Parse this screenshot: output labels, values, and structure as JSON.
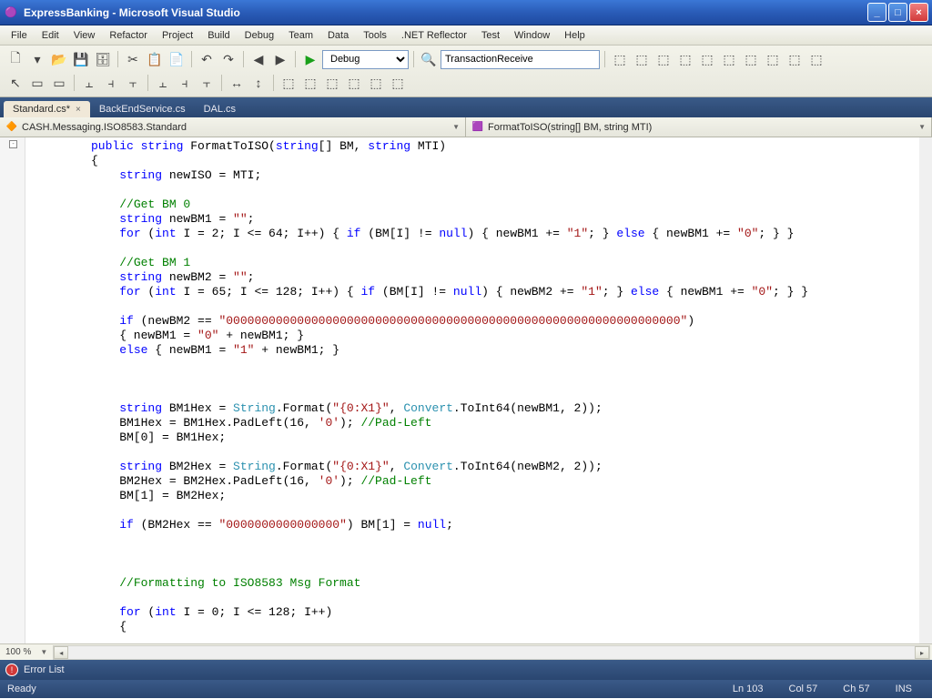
{
  "window": {
    "title": "ExpressBanking - Microsoft Visual Studio"
  },
  "menubar": [
    "File",
    "Edit",
    "View",
    "Refactor",
    "Project",
    "Build",
    "Debug",
    "Team",
    "Data",
    "Tools",
    ".NET Reflector",
    "Test",
    "Window",
    "Help"
  ],
  "toolbar": {
    "config": "Debug",
    "search_value": "TransactionReceive"
  },
  "tabs": [
    {
      "label": "Standard.cs*",
      "active": true,
      "closable": true
    },
    {
      "label": "BackEndService.cs",
      "active": false,
      "closable": false
    },
    {
      "label": "DAL.cs",
      "active": false,
      "closable": false
    }
  ],
  "navdrop": {
    "left": "CASH.Messaging.ISO8583.Standard",
    "right": "FormatToISO(string[] BM, string MTI)"
  },
  "zoom": "100 %",
  "errorlist": "Error List",
  "status": {
    "ready": "Ready",
    "ln": "Ln 103",
    "col": "Col 57",
    "ch": "Ch 57",
    "ins": "INS"
  },
  "code_strings": {
    "zeros64": "\"0000000000000000000000000000000000000000000000000000000000000000\"",
    "zeros16": "\"0000000000000000\"",
    "fmt": "\"{0:X1}\"",
    "zeroChar": "'0'",
    "one": "\"1\"",
    "zero": "\"0\"",
    "empty": "\"\""
  },
  "code_plain": {
    "sig_pref": "public string FormatToISO(string[] BM, string MTI)",
    "newISO": "string newISO = MTI;",
    "getBM0": "//Get BM 0",
    "newBM1decl_pref": "string newBM1 = ",
    "for1_pref": "for (int I = 2; I <= 64; I++) { if (BM[I] != null) { newBM1 += ",
    "for1_mid": "; } else { newBM1 += ",
    "for1_end": "; } }",
    "getBM1": "//Get BM 1",
    "newBM2decl_pref": "string newBM2 = ",
    "for2_pref": "for (int I = 65; I <= 128; I++) { if (BM[I] != null) { newBM2 += ",
    "ifzeros_pref": "if (newBM2 == ",
    "ifzeros_suf": ")",
    "assign_zero_pref": "{ newBM1 = ",
    "assign_zero_suf": " + newBM1; }",
    "else_pref": "else { newBM1 = ",
    "bm1hex_pref": "string BM1Hex = String.Format(",
    "bm1hex_mid": ", Convert.ToInt64(newBM1, 2));",
    "bm1pad_pref": "BM1Hex = BM1Hex.PadLeft(16, ",
    "pad_suf": "); ",
    "padcom": "//Pad-Left",
    "bm0assign": "BM[0] = BM1Hex;",
    "bm2hex_pref": "string BM2Hex = String.Format(",
    "bm2hex_mid": ", Convert.ToInt64(newBM2, 2));",
    "bm2pad_pref": "BM2Hex = BM2Hex.PadLeft(16, ",
    "bm1assign": "BM[1] = BM2Hex;",
    "ifbm2hex_pref": "if (BM2Hex == ",
    "ifbm2hex_suf": ") BM[1] = null;",
    "fmtcom": "//Formatting to ISO8583 Msg Format",
    "for3": "for (int I = 0; I <= 128; I++)",
    "lbr": "{",
    "semi": ";"
  }
}
